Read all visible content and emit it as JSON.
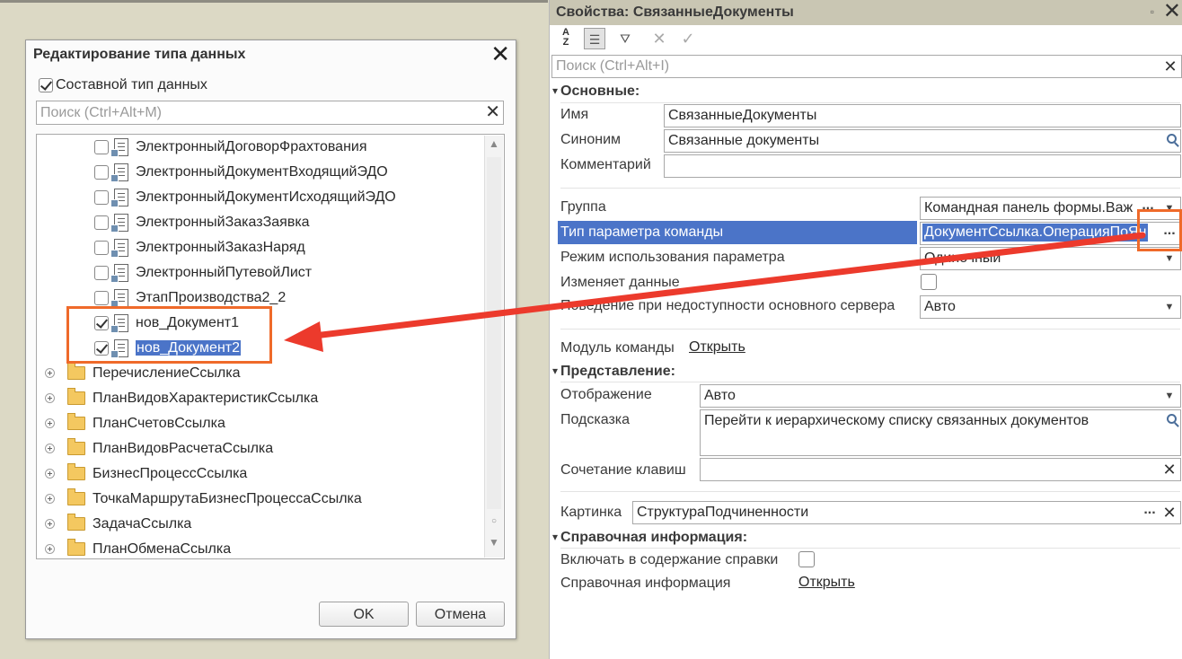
{
  "dialog": {
    "title": "Редактирование типа данных",
    "composite_label": "Составной тип данных",
    "composite_checked": true,
    "search_placeholder": "Поиск (Ctrl+Alt+M)",
    "items": [
      {
        "label": "ЭлектронныйДоговорФрахтования",
        "checked": false
      },
      {
        "label": "ЭлектронныйДокументВходящийЭДО",
        "checked": false
      },
      {
        "label": "ЭлектронныйДокументИсходящийЭДО",
        "checked": false
      },
      {
        "label": "ЭлектронныйЗаказЗаявка",
        "checked": false
      },
      {
        "label": "ЭлектронныйЗаказНаряд",
        "checked": false
      },
      {
        "label": "ЭлектронныйПутевойЛист",
        "checked": false
      },
      {
        "label": "ЭтапПроизводства2_2",
        "checked": false
      },
      {
        "label": "нов_Документ1",
        "checked": true
      },
      {
        "label": "нов_Документ2",
        "checked": true
      }
    ],
    "groups": [
      "ПеречислениеСсылка",
      "ПланВидовХарактеристикСсылка",
      "ПланСчетовСсылка",
      "ПланВидовРасчетаСсылка",
      "БизнесПроцессСсылка",
      "ТочкаМаршрутаБизнесПроцессаСсылка",
      "ЗадачаСсылка",
      "ПланОбменаСсылка"
    ],
    "ok_label": "OK",
    "cancel_label": "Отмена"
  },
  "props": {
    "title": "Свойства: СвязанныеДокументы",
    "search_placeholder": "Поиск (Ctrl+Alt+I)",
    "sections": {
      "main": "Основные:",
      "view": "Представление:",
      "help": "Справочная информация:"
    },
    "name_label": "Имя",
    "name_value": "СвязанныеДокументы",
    "synonym_label": "Синоним",
    "synonym_value": "Связанные документы",
    "comment_label": "Комментарий",
    "comment_value": "",
    "group_label": "Группа",
    "group_value": "Командная панель формы.Важ",
    "param_type_label": "Тип параметра команды",
    "param_type_value": "ДокументСсылка.ОперацияПоЯн",
    "param_mode_label": "Режим использования параметра",
    "param_mode_value": "Одиночный",
    "changes_data_label": "Изменяет данные",
    "behavior_label": "Поведение при недоступности основного сервера",
    "behavior_value": "Авто",
    "module_label": "Модуль команды",
    "module_link": "Открыть",
    "display_label": "Отображение",
    "display_value": "Авто",
    "tooltip_label": "Подсказка",
    "tooltip_value": "Перейти к иерархическому списку связанных документов",
    "shortcut_label": "Сочетание клавиш",
    "shortcut_value": "",
    "picture_label": "Картинка",
    "picture_value": "СтруктураПодчиненности",
    "include_help_label": "Включать в содержание справки",
    "help_info_label": "Справочная информация",
    "help_info_link": "Открыть",
    "dots": "...",
    "pin_icon": "▫"
  }
}
